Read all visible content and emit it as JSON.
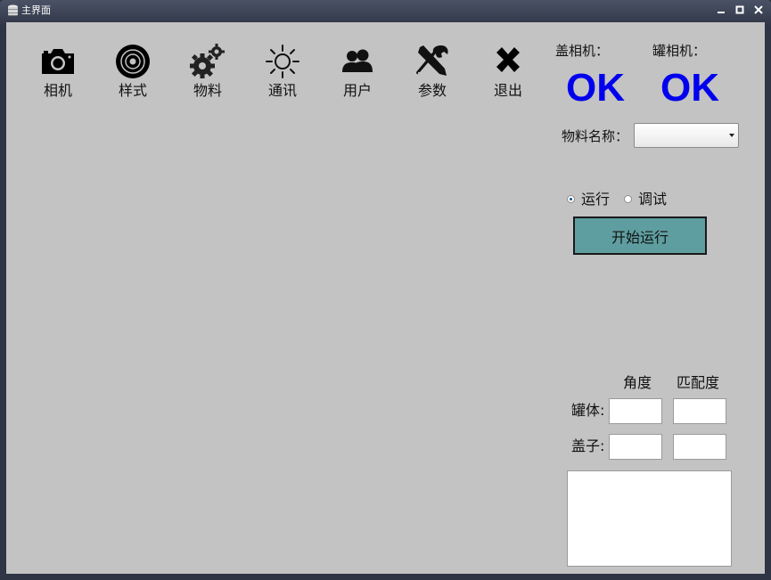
{
  "window": {
    "title": "主界面",
    "controls": {
      "minimize": "🗕",
      "maximize": "▢",
      "close": "✕"
    }
  },
  "toolbar": {
    "items": [
      {
        "label": "相机",
        "icon": "camera-icon"
      },
      {
        "label": "样式",
        "icon": "disc-icon"
      },
      {
        "label": "物料",
        "icon": "gears-icon"
      },
      {
        "label": "通讯",
        "icon": "sun-icon"
      },
      {
        "label": "用户",
        "icon": "users-icon"
      },
      {
        "label": "参数",
        "icon": "tools-icon"
      },
      {
        "label": "退出",
        "icon": "close-x-icon"
      }
    ]
  },
  "status": {
    "lid_camera_label": "盖相机：",
    "lid_camera_value": "OK",
    "can_camera_label": "罐相机：",
    "can_camera_value": "OK",
    "ok_color": "#0000ee"
  },
  "material": {
    "label": "物料名称：",
    "selected": ""
  },
  "mode": {
    "run_label": "运行",
    "debug_label": "调试",
    "selected": "run"
  },
  "start_button": {
    "label": "开始运行",
    "color": "#5f9ea0"
  },
  "results": {
    "col_angle": "角度",
    "col_match": "匹配度",
    "row_can": "罐体:",
    "row_lid": "盖子:",
    "can_angle": "",
    "can_match": "",
    "lid_angle": "",
    "lid_match": ""
  }
}
